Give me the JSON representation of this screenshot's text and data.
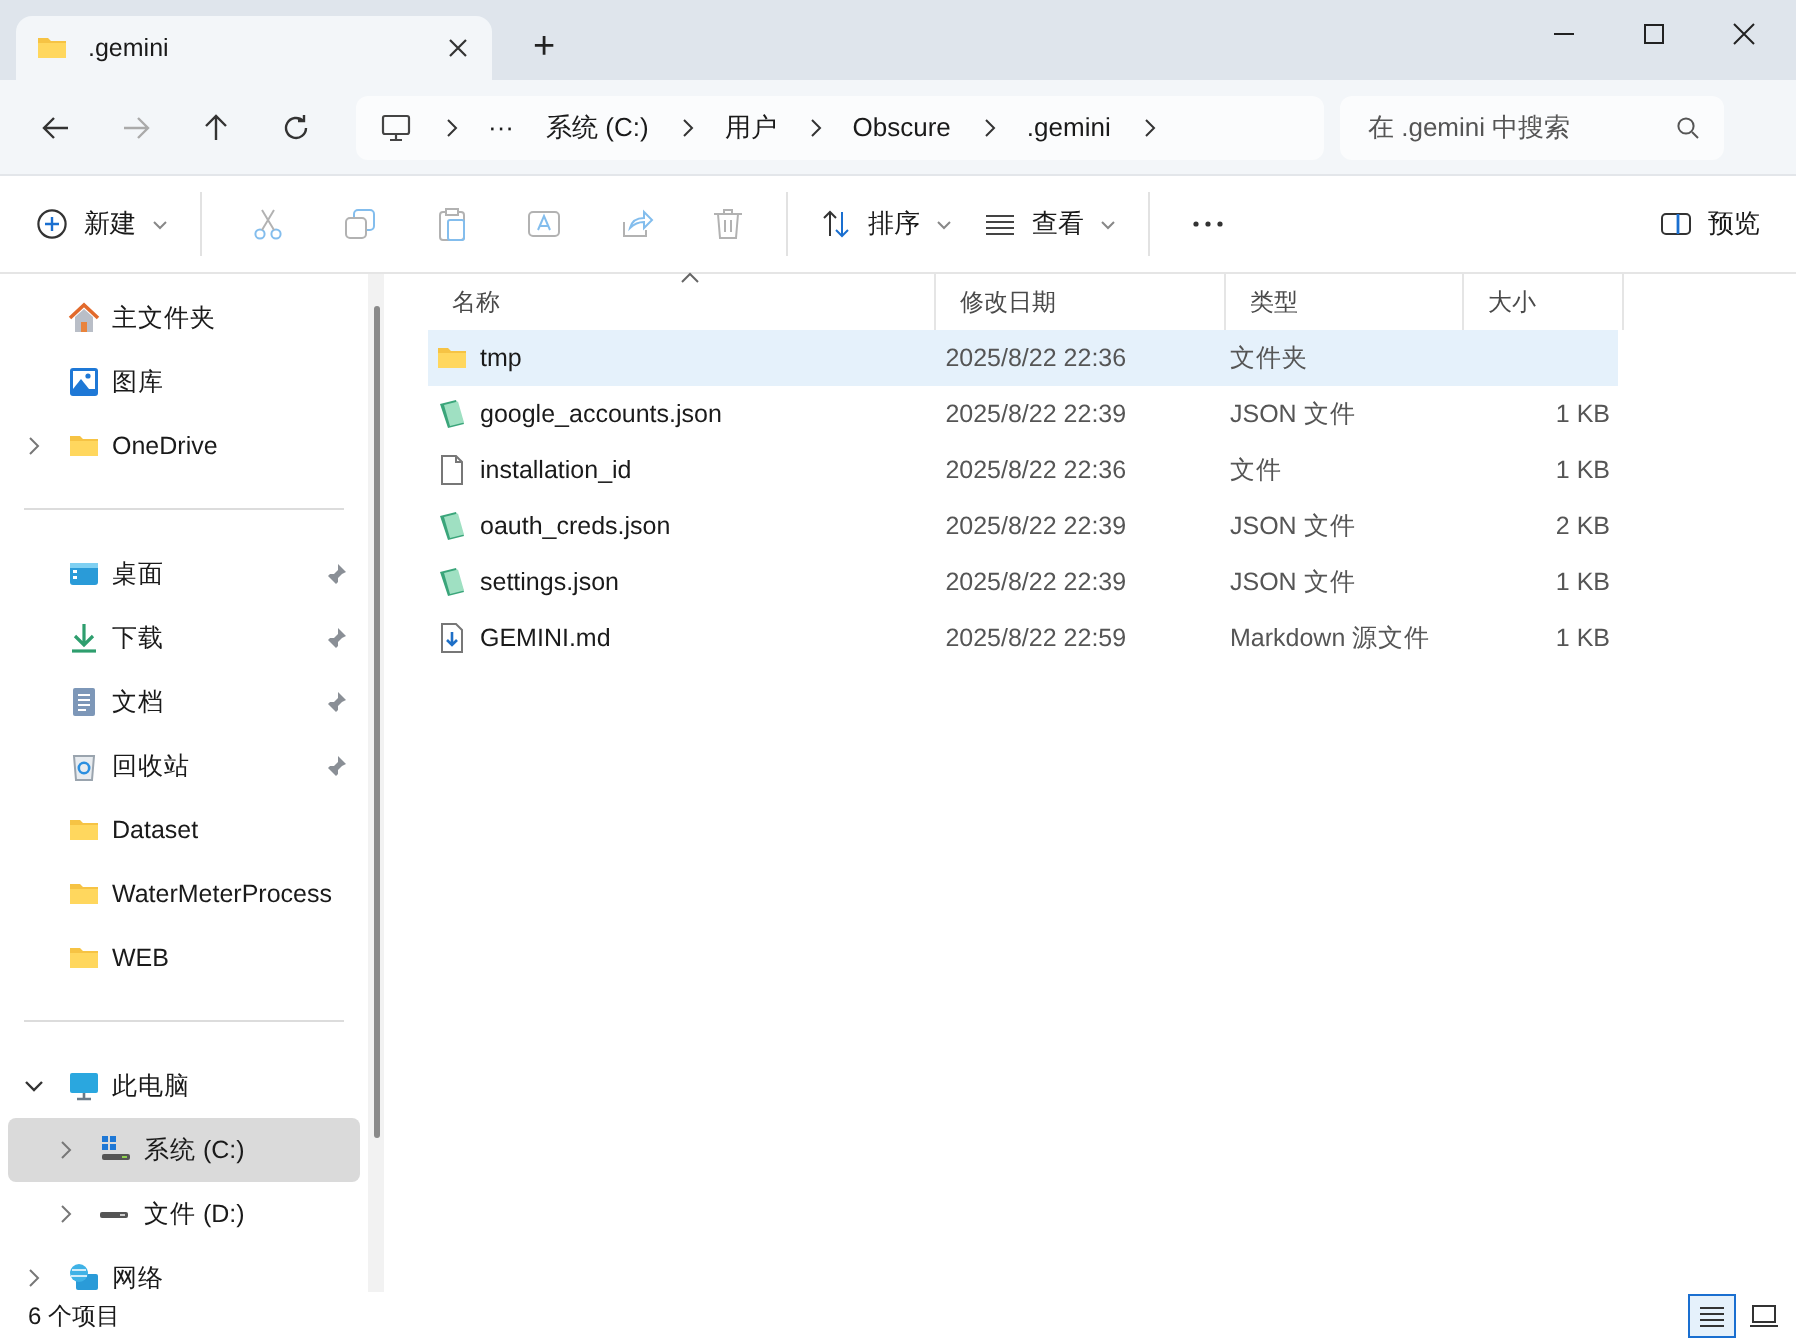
{
  "window": {
    "tab_title": ".gemini",
    "new_tab": "+"
  },
  "address": {
    "overflow": "···",
    "path": [
      "系统 (C:)",
      "用户",
      "Obscure",
      ".gemini"
    ]
  },
  "search": {
    "placeholder": "在 .gemini 中搜索"
  },
  "toolbar": {
    "new": "新建",
    "actions": [
      {
        "kind": "cut",
        "disabled": true
      },
      {
        "kind": "copy",
        "disabled": true
      },
      {
        "kind": "paste",
        "disabled": true
      },
      {
        "kind": "rename",
        "disabled": true
      },
      {
        "kind": "share",
        "disabled": true
      },
      {
        "kind": "delete",
        "disabled": true
      }
    ],
    "sort": "排序",
    "view": "查看",
    "preview": "预览"
  },
  "sidebar": {
    "sections": [
      [
        {
          "label": "主文件夹",
          "kind": "home",
          "pinned": false,
          "selected": false
        },
        {
          "label": "图库",
          "kind": "gallery",
          "pinned": false,
          "selected": false
        },
        {
          "label": "OneDrive",
          "kind": "folder",
          "expanded": false,
          "pinned": false,
          "selected": false
        }
      ],
      [
        {
          "label": "桌面",
          "kind": "desktop",
          "pinned": true,
          "selected": false
        },
        {
          "label": "下载",
          "kind": "download",
          "pinned": true,
          "selected": false
        },
        {
          "label": "文档",
          "kind": "document",
          "pinned": true,
          "selected": false
        },
        {
          "label": "回收站",
          "kind": "recycle",
          "pinned": true,
          "selected": false
        },
        {
          "label": "Dataset",
          "kind": "folder",
          "pinned": false,
          "selected": false
        },
        {
          "label": "WaterMeterProcess",
          "kind": "folder",
          "pinned": false,
          "selected": false
        },
        {
          "label": "WEB",
          "kind": "folder",
          "pinned": false,
          "selected": false
        }
      ],
      [
        {
          "label": "此电脑",
          "kind": "pc",
          "expanded": true,
          "pinned": false,
          "selected": false,
          "children": [
            {
              "label": "系统 (C:)",
              "kind": "system-drive",
              "expanded": false,
              "pinned": false,
              "selected": true
            },
            {
              "label": "文件 (D:)",
              "kind": "drive",
              "expanded": false,
              "pinned": false,
              "selected": false
            }
          ]
        },
        {
          "label": "网络",
          "kind": "network",
          "expanded": false,
          "pinned": false,
          "selected": false
        }
      ]
    ]
  },
  "table": {
    "columns": [
      "名称",
      "修改日期",
      "类型",
      "大小"
    ],
    "rows": [
      {
        "name": "tmp",
        "kind": "folder",
        "modified": "2025/8/22 22:36",
        "type": "文件夹",
        "size": "",
        "selected": true
      },
      {
        "name": "google_accounts.json",
        "kind": "json",
        "modified": "2025/8/22 22:39",
        "type": "JSON 文件",
        "size": "1 KB",
        "selected": false
      },
      {
        "name": "installation_id",
        "kind": "file",
        "modified": "2025/8/22 22:36",
        "type": "文件",
        "size": "1 KB",
        "selected": false
      },
      {
        "name": "oauth_creds.json",
        "kind": "json",
        "modified": "2025/8/22 22:39",
        "type": "JSON 文件",
        "size": "2 KB",
        "selected": false
      },
      {
        "name": "settings.json",
        "kind": "json",
        "modified": "2025/8/22 22:39",
        "type": "JSON 文件",
        "size": "1 KB",
        "selected": false
      },
      {
        "name": "GEMINI.md",
        "kind": "markdown",
        "modified": "2025/8/22 22:59",
        "type": "Markdown 源文件",
        "size": "1 KB",
        "selected": false
      }
    ]
  },
  "status_bar": {
    "count": "6 个项目",
    "views": [
      {
        "kind": "details",
        "selected": true
      },
      {
        "kind": "tiles",
        "selected": false
      }
    ]
  }
}
